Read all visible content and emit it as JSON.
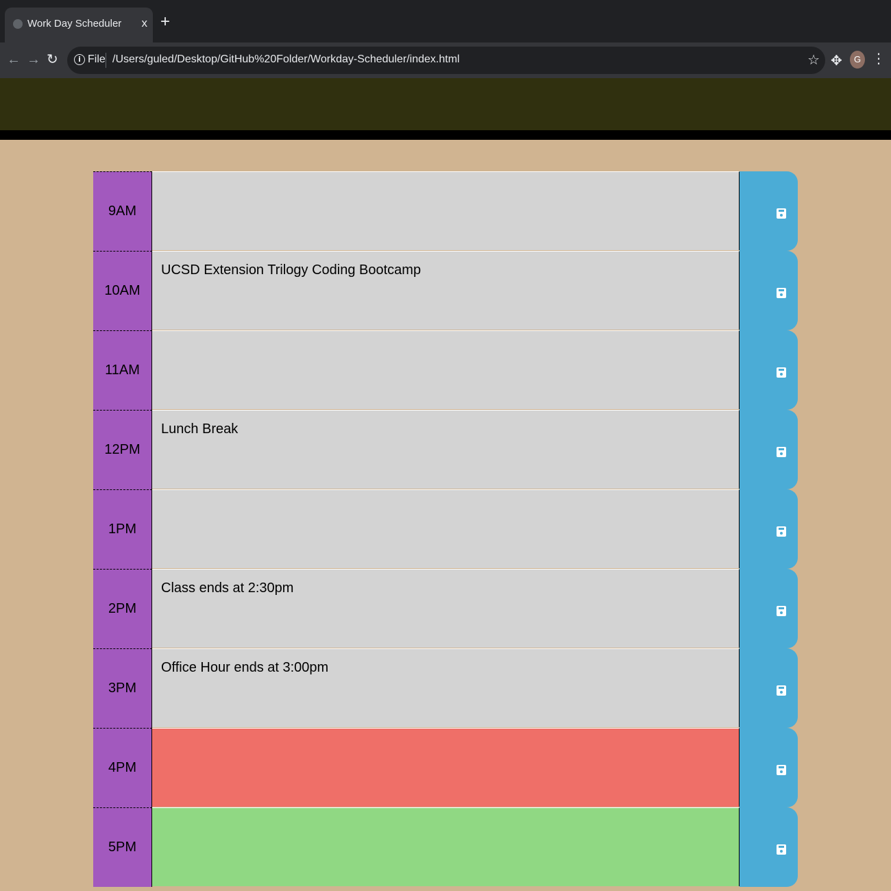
{
  "browser": {
    "tab_title": "Work Day Scheduler",
    "tab_close": "x",
    "new_tab": "+",
    "scheme": "File",
    "url": "/Users/guled/Desktop/GitHub%20Folder/Workday-Scheduler/index.html",
    "avatar_letter": "G"
  },
  "colors": {
    "hour_block": "#a259be",
    "past": "#d3d3d3",
    "present": "#ef6f68",
    "future": "#90d883",
    "save_button": "#4bacd6",
    "page_background": "#d0b491",
    "header_background": "#30300f"
  },
  "schedule": [
    {
      "hour": "9AM",
      "text": "",
      "state": "past"
    },
    {
      "hour": "10AM",
      "text": "UCSD Extension Trilogy Coding Bootcamp",
      "state": "past"
    },
    {
      "hour": "11AM",
      "text": "",
      "state": "past"
    },
    {
      "hour": "12PM",
      "text": "Lunch Break",
      "state": "past"
    },
    {
      "hour": "1PM",
      "text": "",
      "state": "past"
    },
    {
      "hour": "2PM",
      "text": "Class ends at 2:30pm",
      "state": "past"
    },
    {
      "hour": "3PM",
      "text": "Office Hour ends at 3:00pm",
      "state": "past"
    },
    {
      "hour": "4PM",
      "text": "",
      "state": "present"
    },
    {
      "hour": "5PM",
      "text": "",
      "state": "future"
    }
  ]
}
